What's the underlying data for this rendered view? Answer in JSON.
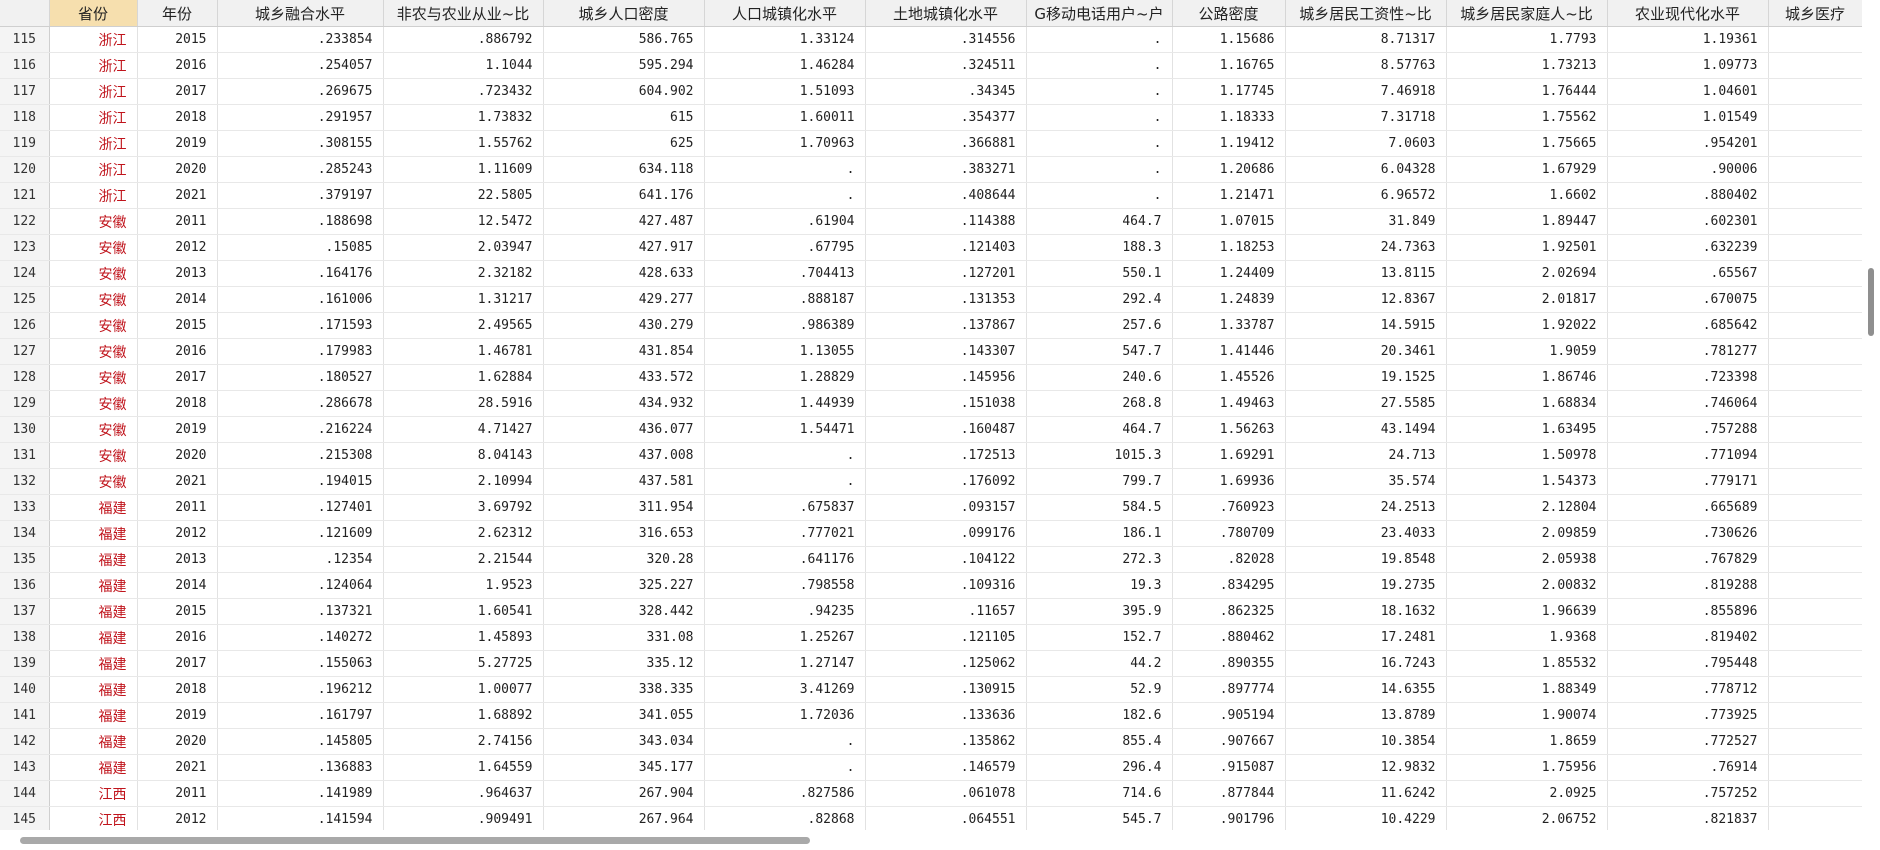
{
  "columns": [
    {
      "label": "",
      "key": "row_number"
    },
    {
      "label": "省份",
      "key": "province",
      "selected": true
    },
    {
      "label": "年份",
      "key": "year"
    },
    {
      "label": "城乡融合水平",
      "key": "integration"
    },
    {
      "label": "非农与农业从业~比",
      "key": "nonfarm_ratio"
    },
    {
      "label": "城乡人口密度",
      "key": "pop_density"
    },
    {
      "label": "人口城镇化水平",
      "key": "pop_urbanization"
    },
    {
      "label": "土地城镇化水平",
      "key": "land_urbanization"
    },
    {
      "label": "G移动电话用户~户",
      "key": "mobile_users"
    },
    {
      "label": "公路密度",
      "key": "road_density"
    },
    {
      "label": "城乡居民工资性~比",
      "key": "wage_ratio"
    },
    {
      "label": "城乡居民家庭人~比",
      "key": "household_ratio"
    },
    {
      "label": "农业现代化水平",
      "key": "agri_modernization"
    },
    {
      "label": "城乡医疗",
      "key": "medical"
    }
  ],
  "rows": [
    [
      "115",
      "浙江",
      "2015",
      ".233854",
      ".886792",
      "586.765",
      "1.33124",
      ".314556",
      ".",
      "1.15686",
      "8.71317",
      "1.7793",
      "1.19361",
      ""
    ],
    [
      "116",
      "浙江",
      "2016",
      ".254057",
      "1.1044",
      "595.294",
      "1.46284",
      ".324511",
      ".",
      "1.16765",
      "8.57763",
      "1.73213",
      "1.09773",
      ""
    ],
    [
      "117",
      "浙江",
      "2017",
      ".269675",
      ".723432",
      "604.902",
      "1.51093",
      ".34345",
      ".",
      "1.17745",
      "7.46918",
      "1.76444",
      "1.04601",
      ""
    ],
    [
      "118",
      "浙江",
      "2018",
      ".291957",
      "1.73832",
      "615",
      "1.60011",
      ".354377",
      ".",
      "1.18333",
      "7.31718",
      "1.75562",
      "1.01549",
      ""
    ],
    [
      "119",
      "浙江",
      "2019",
      ".308155",
      "1.55762",
      "625",
      "1.70963",
      ".366881",
      ".",
      "1.19412",
      "7.0603",
      "1.75665",
      ".954201",
      ""
    ],
    [
      "120",
      "浙江",
      "2020",
      ".285243",
      "1.11609",
      "634.118",
      ".",
      ".383271",
      ".",
      "1.20686",
      "6.04328",
      "1.67929",
      ".90006",
      ""
    ],
    [
      "121",
      "浙江",
      "2021",
      ".379197",
      "22.5805",
      "641.176",
      ".",
      ".408644",
      ".",
      "1.21471",
      "6.96572",
      "1.6602",
      ".880402",
      ""
    ],
    [
      "122",
      "安徽",
      "2011",
      ".188698",
      "12.5472",
      "427.487",
      ".61904",
      ".114388",
      "464.7",
      "1.07015",
      "31.849",
      "1.89447",
      ".602301",
      ""
    ],
    [
      "123",
      "安徽",
      "2012",
      ".15085",
      "2.03947",
      "427.917",
      ".67795",
      ".121403",
      "188.3",
      "1.18253",
      "24.7363",
      "1.92501",
      ".632239",
      ""
    ],
    [
      "124",
      "安徽",
      "2013",
      ".164176",
      "2.32182",
      "428.633",
      ".704413",
      ".127201",
      "550.1",
      "1.24409",
      "13.8115",
      "2.02694",
      ".65567",
      ""
    ],
    [
      "125",
      "安徽",
      "2014",
      ".161006",
      "1.31217",
      "429.277",
      ".888187",
      ".131353",
      "292.4",
      "1.24839",
      "12.8367",
      "2.01817",
      ".670075",
      ""
    ],
    [
      "126",
      "安徽",
      "2015",
      ".171593",
      "2.49565",
      "430.279",
      ".986389",
      ".137867",
      "257.6",
      "1.33787",
      "14.5915",
      "1.92022",
      ".685642",
      ""
    ],
    [
      "127",
      "安徽",
      "2016",
      ".179983",
      "1.46781",
      "431.854",
      "1.13055",
      ".143307",
      "547.7",
      "1.41446",
      "20.3461",
      "1.9059",
      ".781277",
      ""
    ],
    [
      "128",
      "安徽",
      "2017",
      ".180527",
      "1.62884",
      "433.572",
      "1.28829",
      ".145956",
      "240.6",
      "1.45526",
      "19.1525",
      "1.86746",
      ".723398",
      ""
    ],
    [
      "129",
      "安徽",
      "2018",
      ".286678",
      "28.5916",
      "434.932",
      "1.44939",
      ".151038",
      "268.8",
      "1.49463",
      "27.5585",
      "1.68834",
      ".746064",
      ""
    ],
    [
      "130",
      "安徽",
      "2019",
      ".216224",
      "4.71427",
      "436.077",
      "1.54471",
      ".160487",
      "464.7",
      "1.56263",
      "43.1494",
      "1.63495",
      ".757288",
      ""
    ],
    [
      "131",
      "安徽",
      "2020",
      ".215308",
      "8.04143",
      "437.008",
      ".",
      ".172513",
      "1015.3",
      "1.69291",
      "24.713",
      "1.50978",
      ".771094",
      ""
    ],
    [
      "132",
      "安徽",
      "2021",
      ".194015",
      "2.10994",
      "437.581",
      ".",
      ".176092",
      "799.7",
      "1.69936",
      "35.574",
      "1.54373",
      ".779171",
      ""
    ],
    [
      "133",
      "福建",
      "2011",
      ".127401",
      "3.69792",
      "311.954",
      ".675837",
      ".093157",
      "584.5",
      ".760923",
      "24.2513",
      "2.12804",
      ".665689",
      ""
    ],
    [
      "134",
      "福建",
      "2012",
      ".121609",
      "2.62312",
      "316.653",
      ".777021",
      ".099176",
      "186.1",
      ".780709",
      "23.4033",
      "2.09859",
      ".730626",
      ""
    ],
    [
      "135",
      "福建",
      "2013",
      ".12354",
      "2.21544",
      "320.28",
      ".641176",
      ".104122",
      "272.3",
      ".82028",
      "19.8548",
      "2.05938",
      ".767829",
      ""
    ],
    [
      "136",
      "福建",
      "2014",
      ".124064",
      "1.9523",
      "325.227",
      ".798558",
      ".109316",
      "19.3",
      ".834295",
      "19.2735",
      "2.00832",
      ".819288",
      ""
    ],
    [
      "137",
      "福建",
      "2015",
      ".137321",
      "1.60541",
      "328.442",
      ".94235",
      ".11657",
      "395.9",
      ".862325",
      "18.1632",
      "1.96639",
      ".855896",
      ""
    ],
    [
      "138",
      "福建",
      "2016",
      ".140272",
      "1.45893",
      "331.08",
      "1.25267",
      ".121105",
      "152.7",
      ".880462",
      "17.2481",
      "1.9368",
      ".819402",
      ""
    ],
    [
      "139",
      "福建",
      "2017",
      ".155063",
      "5.27725",
      "335.12",
      "1.27147",
      ".125062",
      "44.2",
      ".890355",
      "16.7243",
      "1.85532",
      ".795448",
      ""
    ],
    [
      "140",
      "福建",
      "2018",
      ".196212",
      "1.00077",
      "338.335",
      "3.41269",
      ".130915",
      "52.9",
      ".897774",
      "14.6355",
      "1.88349",
      ".778712",
      ""
    ],
    [
      "141",
      "福建",
      "2019",
      ".161797",
      "1.68892",
      "341.055",
      "1.72036",
      ".133636",
      "182.6",
      ".905194",
      "13.8789",
      "1.90074",
      ".773925",
      ""
    ],
    [
      "142",
      "福建",
      "2020",
      ".145805",
      "2.74156",
      "343.034",
      ".",
      ".135862",
      "855.4",
      ".907667",
      "10.3854",
      "1.8659",
      ".772527",
      ""
    ],
    [
      "143",
      "福建",
      "2021",
      ".136883",
      "1.64559",
      "345.177",
      ".",
      ".146579",
      "296.4",
      ".915087",
      "12.9832",
      "1.75956",
      ".76914",
      ""
    ],
    [
      "144",
      "江西",
      "2011",
      ".141989",
      ".964637",
      "267.904",
      ".827586",
      ".061078",
      "714.6",
      ".877844",
      "11.6242",
      "2.0925",
      ".757252",
      ""
    ],
    [
      "145",
      "江西",
      "2012",
      ".141594",
      ".909491",
      "267.964",
      ".82868",
      ".064551",
      "545.7",
      ".901796",
      "10.4229",
      "2.06752",
      ".821837",
      ""
    ]
  ]
}
